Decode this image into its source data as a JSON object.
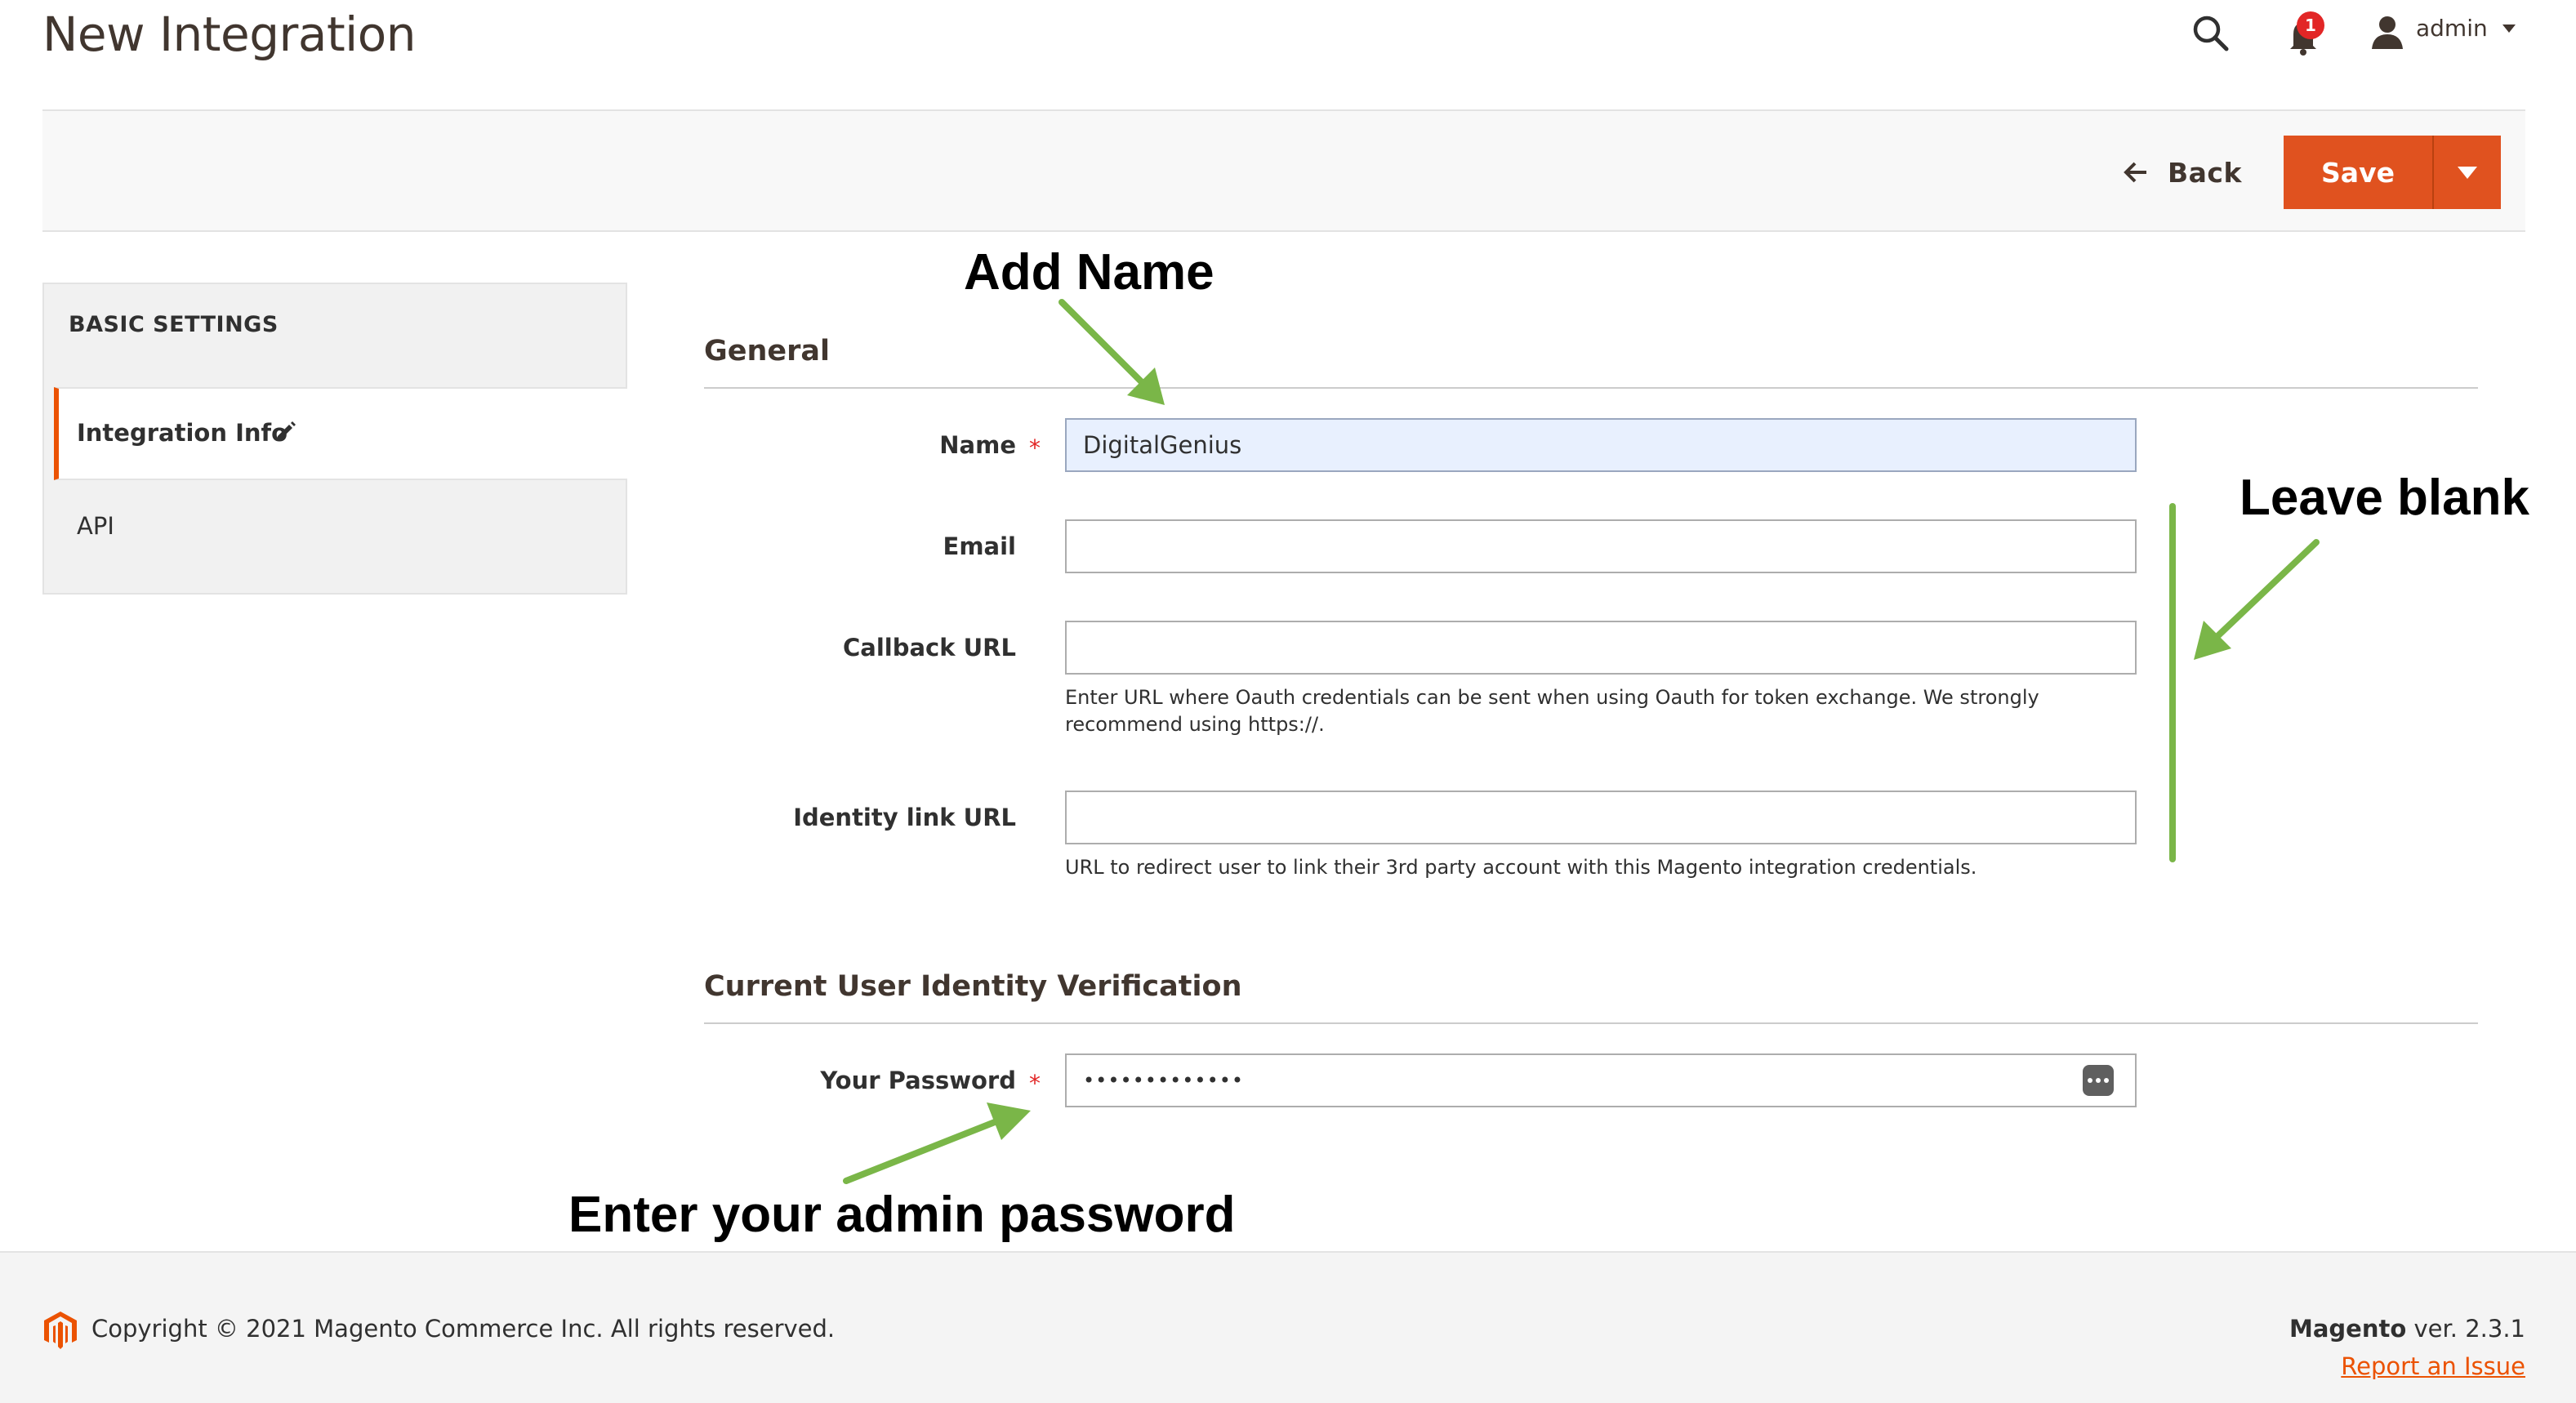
{
  "header": {
    "title": "New Integration",
    "notification_count": "1",
    "user_name": "admin"
  },
  "actions": {
    "back_label": "Back",
    "save_label": "Save"
  },
  "sidebar": {
    "heading": "BASIC SETTINGS",
    "items": [
      {
        "label": "Integration Info",
        "active": true
      },
      {
        "label": "API",
        "active": false
      }
    ]
  },
  "form": {
    "general_title": "General",
    "name_label": "Name",
    "name_value": "DigitalGenius",
    "email_label": "Email",
    "email_value": "",
    "callback_label": "Callback URL",
    "callback_value": "",
    "callback_note": "Enter URL where Oauth credentials can be sent when using Oauth for token exchange. We strongly recommend using https://.",
    "identity_label": "Identity link URL",
    "identity_value": "",
    "identity_note": "URL to redirect user to link their 3rd party account with this Magento integration credentials.",
    "verification_title": "Current User Identity Verification",
    "password_label": "Your Password",
    "password_value": "•••••••••••••",
    "required_mark": "*"
  },
  "annotations": {
    "add_name": "Add Name",
    "leave_blank": "Leave blank",
    "enter_password": "Enter your admin password",
    "arrow_color": "#7ab648"
  },
  "footer": {
    "copyright": "Copyright © 2021 Magento Commerce Inc. All rights reserved.",
    "brand": "Magento",
    "version": " ver. 2.3.1",
    "report_link": "Report an Issue"
  },
  "colors": {
    "accent": "#eb5202",
    "save_button": "#e0521f",
    "required": "#e22626",
    "autofill": "#e8f0fe"
  },
  "icons": [
    "search-icon",
    "bell-icon",
    "user-icon",
    "back-arrow-icon",
    "chevron-down-icon",
    "pencil-icon",
    "password-reveal-icon",
    "magento-logo-icon"
  ]
}
